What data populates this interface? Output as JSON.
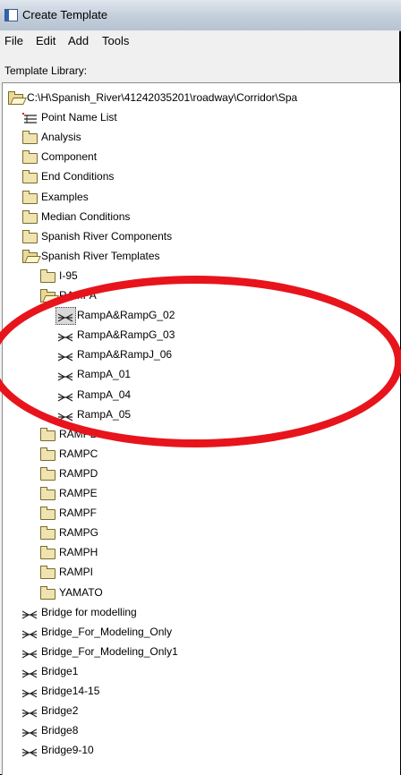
{
  "window": {
    "title": "Create Template"
  },
  "menu": [
    {
      "id": "file",
      "label": "File"
    },
    {
      "id": "edit",
      "label": "Edit"
    },
    {
      "id": "add",
      "label": "Add"
    },
    {
      "id": "tools",
      "label": "Tools"
    }
  ],
  "library": {
    "label": "Template Library:",
    "rows": [
      {
        "label": "C:\\H\\Spanish_River\\41242035201\\roadway\\Corridor\\Spa",
        "icon": "open-folder-icon",
        "level": 0
      },
      {
        "label": "Point Name List",
        "icon": "point-list-icon",
        "level": 1
      },
      {
        "label": "Analysis",
        "icon": "folder-icon",
        "level": 1
      },
      {
        "label": "Component",
        "icon": "folder-icon",
        "level": 1
      },
      {
        "label": "End Conditions",
        "icon": "folder-icon",
        "level": 1
      },
      {
        "label": "Examples",
        "icon": "folder-icon",
        "level": 1
      },
      {
        "label": "Median Conditions",
        "icon": "folder-icon",
        "level": 1
      },
      {
        "label": "Spanish River Components",
        "icon": "folder-icon",
        "level": 1
      },
      {
        "label": "Spanish River Templates",
        "icon": "open-folder-icon",
        "level": 1
      },
      {
        "label": "I-95",
        "icon": "folder-icon",
        "level": 2
      },
      {
        "label": "RAMPA",
        "icon": "open-folder-icon",
        "level": 2
      },
      {
        "label": "RampA&RampG_02",
        "icon": "template-icon",
        "level": 3,
        "selected": true
      },
      {
        "label": "RampA&RampG_03",
        "icon": "template-icon",
        "level": 3
      },
      {
        "label": "RampA&RampJ_06",
        "icon": "template-icon",
        "level": 3
      },
      {
        "label": "RampA_01",
        "icon": "template-icon",
        "level": 3
      },
      {
        "label": "RampA_04",
        "icon": "template-icon",
        "level": 3
      },
      {
        "label": "RampA_05",
        "icon": "template-icon",
        "level": 3
      },
      {
        "label": "RAMPB",
        "icon": "folder-icon",
        "level": 2
      },
      {
        "label": "RAMPC",
        "icon": "folder-icon",
        "level": 2
      },
      {
        "label": "RAMPD",
        "icon": "folder-icon",
        "level": 2
      },
      {
        "label": "RAMPE",
        "icon": "folder-icon",
        "level": 2
      },
      {
        "label": "RAMPF",
        "icon": "folder-icon",
        "level": 2
      },
      {
        "label": "RAMPG",
        "icon": "folder-icon",
        "level": 2
      },
      {
        "label": "RAMPH",
        "icon": "folder-icon",
        "level": 2
      },
      {
        "label": "RAMPI",
        "icon": "folder-icon",
        "level": 2
      },
      {
        "label": "YAMATO",
        "icon": "folder-icon",
        "level": 2
      },
      {
        "label": "Bridge for modelling",
        "icon": "template-icon",
        "level": 1
      },
      {
        "label": "Bridge_For_Modeling_Only",
        "icon": "template-icon",
        "level": 1
      },
      {
        "label": "Bridge_For_Modeling_Only1",
        "icon": "template-icon",
        "level": 1
      },
      {
        "label": "Bridge1",
        "icon": "template-icon",
        "level": 1
      },
      {
        "label": "Bridge14-15",
        "icon": "template-icon",
        "level": 1
      },
      {
        "label": "Bridge2",
        "icon": "template-icon",
        "level": 1
      },
      {
        "label": "Bridge8",
        "icon": "template-icon",
        "level": 1
      },
      {
        "label": "Bridge9-10",
        "icon": "template-icon",
        "level": 1
      }
    ]
  },
  "annotation": {
    "color": "#e8141c"
  }
}
